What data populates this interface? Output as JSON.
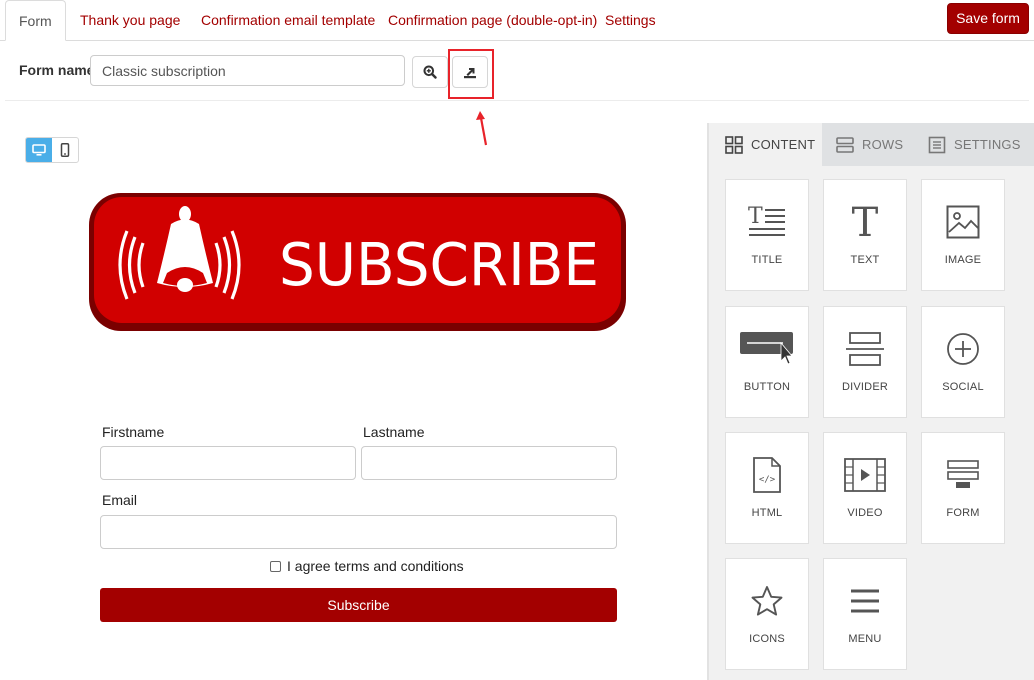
{
  "tabs": [
    {
      "label": "Form",
      "active": true
    },
    {
      "label": "Thank you page"
    },
    {
      "label": "Confirmation email template"
    },
    {
      "label": "Confirmation page (double-opt-in)"
    },
    {
      "label": "Settings"
    }
  ],
  "save_button": "Save form",
  "form_name": {
    "label": "Form name",
    "value": "Classic subscription"
  },
  "toolbar_icons": [
    "zoom-in-icon",
    "export-icon"
  ],
  "device_toggle": {
    "selected": "desktop",
    "options": [
      "desktop-icon",
      "mobile-icon"
    ]
  },
  "banner": {
    "text": "SUBSCRIBE",
    "icon": "bell-icon",
    "color": "#d10000"
  },
  "form": {
    "firstname_label": "Firstname",
    "lastname_label": "Lastname",
    "email_label": "Email",
    "agree_label": "I agree terms and conditions",
    "submit_label": "Subscribe"
  },
  "panel": {
    "tabs": [
      {
        "label": "CONTENT",
        "icon": "grid-icon",
        "active": true
      },
      {
        "label": "ROWS",
        "icon": "rows-icon"
      },
      {
        "label": "SETTINGS",
        "icon": "settings-icon"
      }
    ],
    "tiles": [
      {
        "label": "TITLE",
        "icon": "title-icon"
      },
      {
        "label": "TEXT",
        "icon": "text-icon"
      },
      {
        "label": "IMAGE",
        "icon": "image-icon"
      },
      {
        "label": "BUTTON",
        "icon": "button-icon"
      },
      {
        "label": "DIVIDER",
        "icon": "divider-icon"
      },
      {
        "label": "SOCIAL",
        "icon": "social-icon"
      },
      {
        "label": "HTML",
        "icon": "html-icon"
      },
      {
        "label": "VIDEO",
        "icon": "video-icon"
      },
      {
        "label": "FORM",
        "icon": "form-icon"
      },
      {
        "label": "ICONS",
        "icon": "star-icon"
      },
      {
        "label": "MENU",
        "icon": "menu-icon"
      }
    ]
  },
  "colors": {
    "brand": "#a30000",
    "annotation": "#e8232a",
    "device_active": "#4aaee8"
  }
}
